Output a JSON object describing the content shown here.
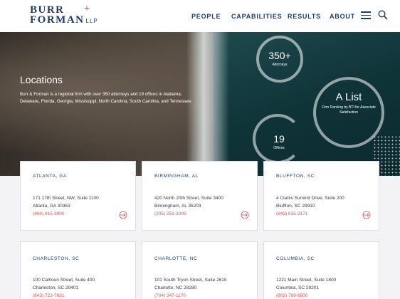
{
  "header": {
    "logo_line1": "BURR",
    "logo_line2": "FORMAN",
    "logo_suffix": "LLP",
    "nav": [
      "PEOPLE",
      "CAPABILITIES",
      "RESULTS",
      "ABOUT"
    ],
    "icons": [
      "hamburger-menu-icon",
      "search-icon"
    ]
  },
  "hero": {
    "title": "Locations",
    "description": "Burr & Forman is a regional firm with over 350 attorneys and 19 offices in Alabama, Delaware, Florida, Georgia, Mississippi, North Carolina, South Carolina, and Tennessee.",
    "stats": {
      "attorneys": {
        "value": "350+",
        "label": "Attorneys"
      },
      "list": {
        "value": "A List",
        "label": "Firm Ranking by BTI for Associate Satisfaction"
      },
      "offices": {
        "value": "19",
        "label": "Offices"
      }
    }
  },
  "offices": [
    {
      "city": "ATLANTA, GA",
      "address1": "171 17th Street, NW, Suite 1100",
      "address2": "Atlanta, GA 30363",
      "phone": "(404) 815-3000"
    },
    {
      "city": "BIRMINGHAM, AL",
      "address1": "420 North 20th Street, Suite 3400",
      "address2": "Birmingham, AL 35203",
      "phone": "(205) 251-3000"
    },
    {
      "city": "BLUFFTON, SC",
      "address1": "4 Clarks Summit Drive, Suite 200",
      "address2": "Bluffton, SC 29910",
      "phone": "(843) 815-2171"
    },
    {
      "city": "CHARLESTON, SC",
      "address1": "100 Calhoun Street, Suite 400",
      "address2": "Charleston, SC 29401",
      "phone": "(843) 723-7831"
    },
    {
      "city": "CHARLOTTE, NC",
      "address1": "101 South Tryon Street, Suite 2610",
      "address2": "Charlotte, NC 28280",
      "phone": "(704) 347-1170"
    },
    {
      "city": "COLUMBIA, SC",
      "address1": "1221 Main Street, Suite 1800",
      "address2": "Columbia, SC 29201",
      "phone": "(803) 799-9800"
    }
  ],
  "colors": {
    "brand": "#1f3b72",
    "accent": "#d9534f"
  }
}
